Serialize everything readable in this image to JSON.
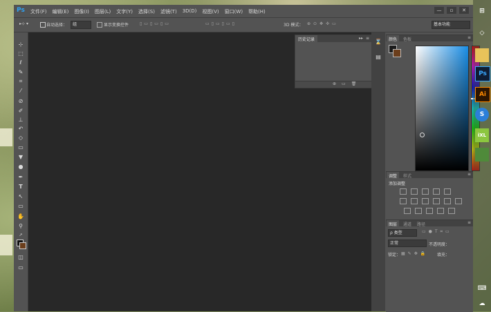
{
  "app": {
    "logo": "Ps",
    "menu": [
      "文件(F)",
      "编辑(E)",
      "图像(I)",
      "图层(L)",
      "文字(Y)",
      "选择(S)",
      "滤镜(T)",
      "3D(D)",
      "视图(V)",
      "窗口(W)",
      "帮助(H)"
    ],
    "window_controls": [
      "—",
      "▫",
      "✕"
    ]
  },
  "options_bar": {
    "auto_select_label": "自动选择：",
    "auto_select_value": "组",
    "show_transform_label": "显示变换控件",
    "mode_3d_label": "3D 模式：",
    "workspace_value": "基本功能"
  },
  "history_panel": {
    "tab": "历史记录"
  },
  "color_panel": {
    "tabs": [
      "颜色",
      "色板"
    ],
    "colors": {
      "foreground": "#1b1b1b",
      "background": "#6b3e1c",
      "pure_hue": "#1a8ee6"
    }
  },
  "adjust_panel": {
    "tabs": [
      "调整",
      "样式"
    ],
    "add_label": "添加调整"
  },
  "layers_panel": {
    "tabs": [
      "图层",
      "通道",
      "路径"
    ],
    "filter_value": "ρ 类型",
    "blend_value": "正常",
    "opacity_label": "不透明度：",
    "lock_label": "锁定：",
    "fill_label": "填充："
  },
  "taskbar": {
    "icons": [
      "windows-icon",
      "network-icon",
      "folder-icon",
      "ps-icon",
      "ai-icon",
      "sogou-icon",
      "ixl-icon",
      "image-icon",
      "keyboard-icon",
      "cloud-icon"
    ],
    "ps_label": "Ps",
    "ai_label": "Ai",
    "sogou_label": "S",
    "ixl_label": "iXL"
  }
}
